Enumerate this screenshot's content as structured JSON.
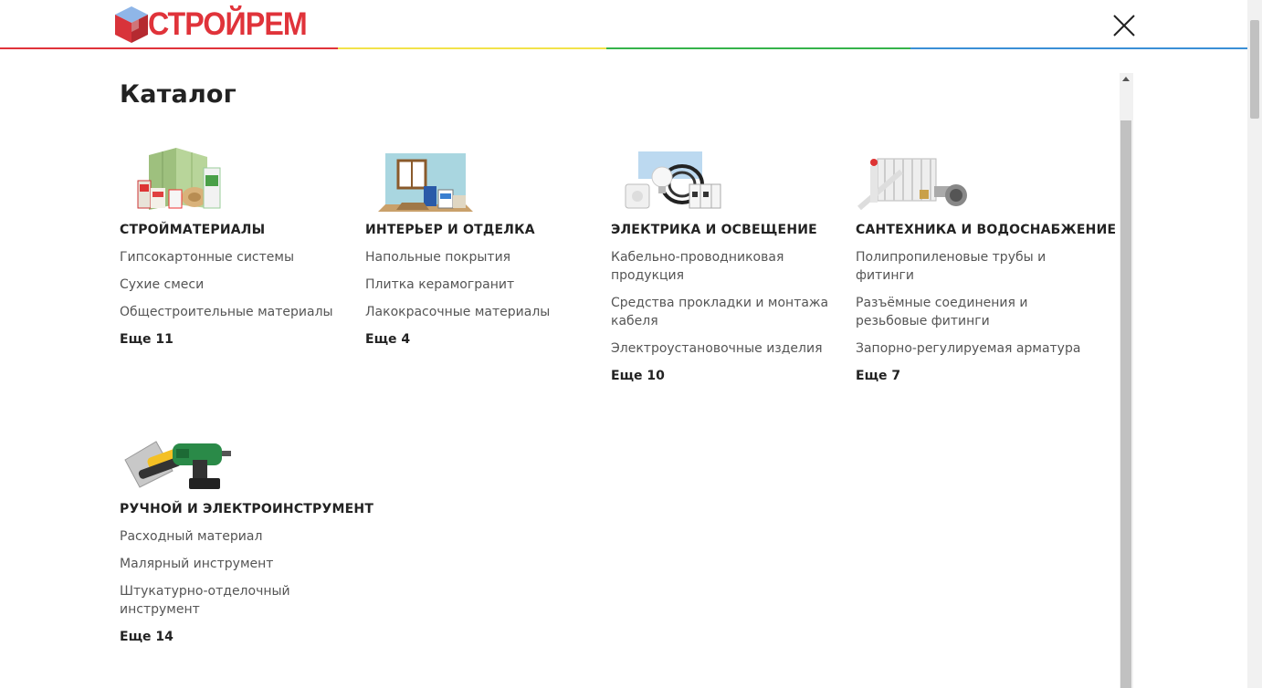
{
  "header": {
    "logo_text": "СТРОЙРЕМ",
    "colors": [
      "#e0333a",
      "#f2e24a",
      "#35b34a",
      "#3a8fd6"
    ]
  },
  "title": "Каталог",
  "categories": [
    {
      "title": "СТРОЙМАТЕРИАЛЫ",
      "items": [
        "Гипсокартонные системы",
        "Сухие смеси",
        "Общестроительные материалы"
      ],
      "more": "Еще 11"
    },
    {
      "title": "ИНТЕРЬЕР И ОТДЕЛКА",
      "items": [
        "Напольные покрытия",
        "Плитка керамогранит",
        "Лакокрасочные материалы"
      ],
      "more": "Еще 4"
    },
    {
      "title": "ЭЛЕКТРИКА И ОСВЕЩЕНИЕ",
      "items": [
        "Кабельно-проводниковая продукция",
        "Средства прокладки и монтажа кабеля",
        "Электроустановочные изделия"
      ],
      "more": "Еще 10"
    },
    {
      "title": "САНТЕХНИКА И ВОДОСНАБЖЕНИЕ",
      "items": [
        "Полипропиленовые трубы и фитинги",
        "Разъёмные соединения и резьбовые фитинги",
        "Запорно-регулируемая арматура"
      ],
      "more": "Еще 7"
    },
    {
      "title": "РУЧНОЙ И ЭЛЕКТРОИНСТРУМЕНТ",
      "items": [
        "Расходный материал",
        "Малярный инструмент",
        "Штукатурно-отделочный инструмент"
      ],
      "more": "Еще 14"
    }
  ]
}
